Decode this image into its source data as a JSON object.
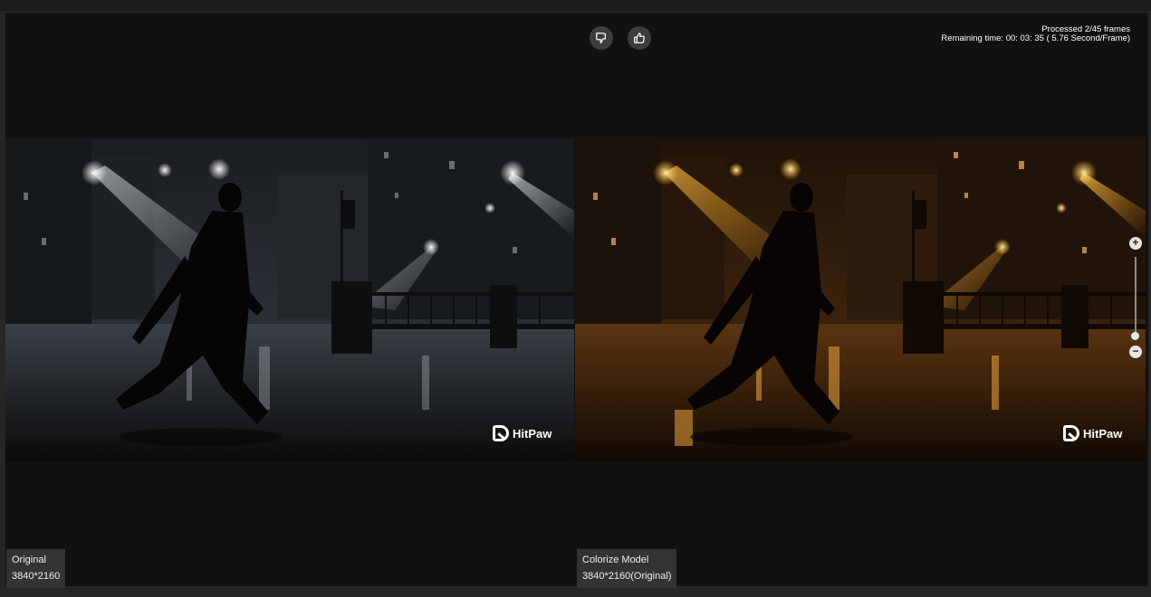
{
  "feedback": {
    "dislike_icon": "thumbs-down-icon",
    "like_icon": "thumbs-up-icon"
  },
  "status": {
    "processed": "Processed 2/45 frames",
    "remaining": "Remaining time: 00: 03: 35 ( 5.76 Second/Frame)"
  },
  "panels": {
    "left": {
      "title": "Original",
      "resolution": "3840*2160",
      "watermark": "HitPaw",
      "tone": "grayscale"
    },
    "right": {
      "title": "Colorize Model",
      "resolution": "3840*2160(Original)",
      "watermark": "HitPaw",
      "tone": "warm-orange"
    }
  },
  "zoom": {
    "plus_label": "+",
    "minus_label": "−",
    "level_fraction": 0.0
  },
  "colors": {
    "background": "#111111",
    "label_bg": "#333333",
    "accent_warm": "#f0a030",
    "light_cool": "#d8dde2"
  }
}
